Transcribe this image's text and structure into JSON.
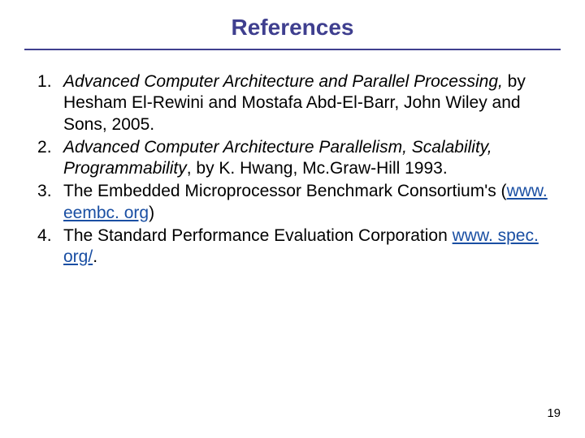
{
  "title": "References",
  "references": [
    {
      "italic": "Advanced Computer Architecture and Parallel Processing,",
      "rest": " by Hesham El-Rewini and Mostafa Abd-El-Barr, John Wiley and Sons, 2005."
    },
    {
      "italic": "Advanced Computer Architecture Parallelism, Scalability, Programmability",
      "rest": ", by  K. Hwang, Mc.Graw-Hill 1993."
    },
    {
      "pre": "The Embedded Microprocessor Benchmark Consortium's (",
      "link": "www. eembc. org",
      "post": ")"
    },
    {
      "pre": "The Standard Performance Evaluation Corporation ",
      "link": "www. spec. org/",
      "post": "."
    }
  ],
  "page_number": "19"
}
